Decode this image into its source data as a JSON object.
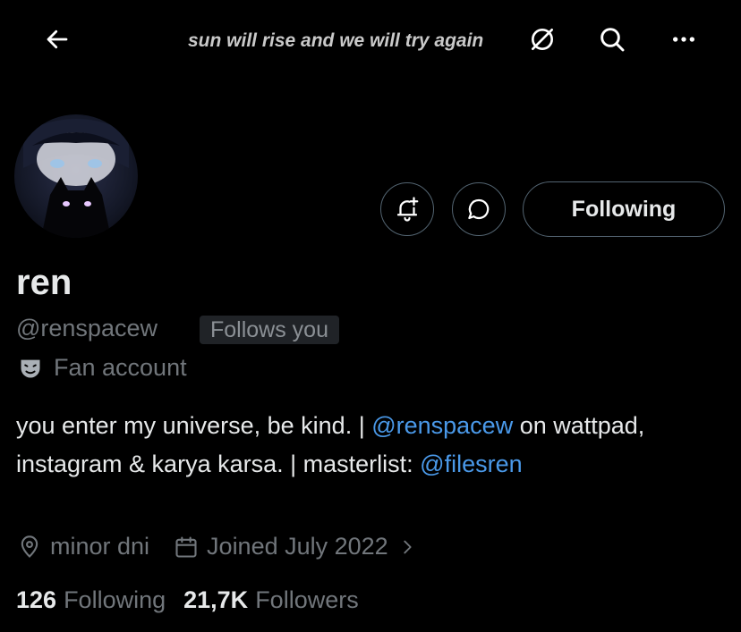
{
  "header": {
    "banner_text": "sun will rise and we will try again",
    "icons": [
      "back-arrow-icon",
      "link-slash-icon",
      "search-icon",
      "more-icon"
    ]
  },
  "profile": {
    "name": "ren",
    "handle": "@renspacew",
    "follows_you": "Follows you",
    "category": "Fan account",
    "following_button": "Following",
    "bio": {
      "part1": "you enter my universe, be kind. | ",
      "mention1": "@renspacew",
      "part2": " on wattpad, instagram & karya karsa. | masterlist: ",
      "mention2": "@filesren"
    },
    "location": "minor dni",
    "joined": "Joined July 2022",
    "following_count": "126",
    "following_label": "Following",
    "followers_count": "21,7K",
    "followers_label": "Followers"
  },
  "colors": {
    "accent": "#4a99e9",
    "muted": "#71767b",
    "text": "#e7e9ea",
    "border": "#536471"
  }
}
